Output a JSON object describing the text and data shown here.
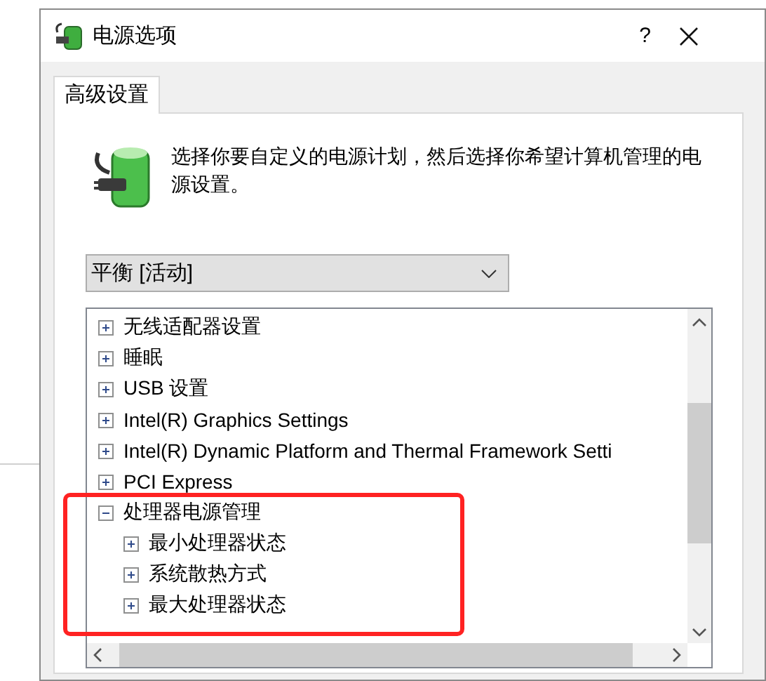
{
  "window": {
    "title": "电源选项",
    "help_button": "?"
  },
  "tabs": [
    {
      "label": "高级设置",
      "selected": true
    }
  ],
  "description": "选择你要自定义的电源计划，然后选择你希望计算机管理的电源设置。",
  "plan_dropdown": {
    "value": "平衡 [活动]"
  },
  "settings_tree": [
    {
      "label": "无线适配器设置",
      "expanded": false
    },
    {
      "label": "睡眠",
      "expanded": false
    },
    {
      "label": "USB 设置",
      "expanded": false
    },
    {
      "label": "Intel(R) Graphics Settings",
      "expanded": false
    },
    {
      "label": "Intel(R) Dynamic Platform and Thermal Framework Setti",
      "expanded": false
    },
    {
      "label": "PCI Express",
      "expanded": false
    },
    {
      "label": "处理器电源管理",
      "expanded": true,
      "children": [
        {
          "label": "最小处理器状态",
          "expanded": false
        },
        {
          "label": "系统散热方式",
          "expanded": false
        },
        {
          "label": "最大处理器状态",
          "expanded": false
        }
      ]
    }
  ]
}
